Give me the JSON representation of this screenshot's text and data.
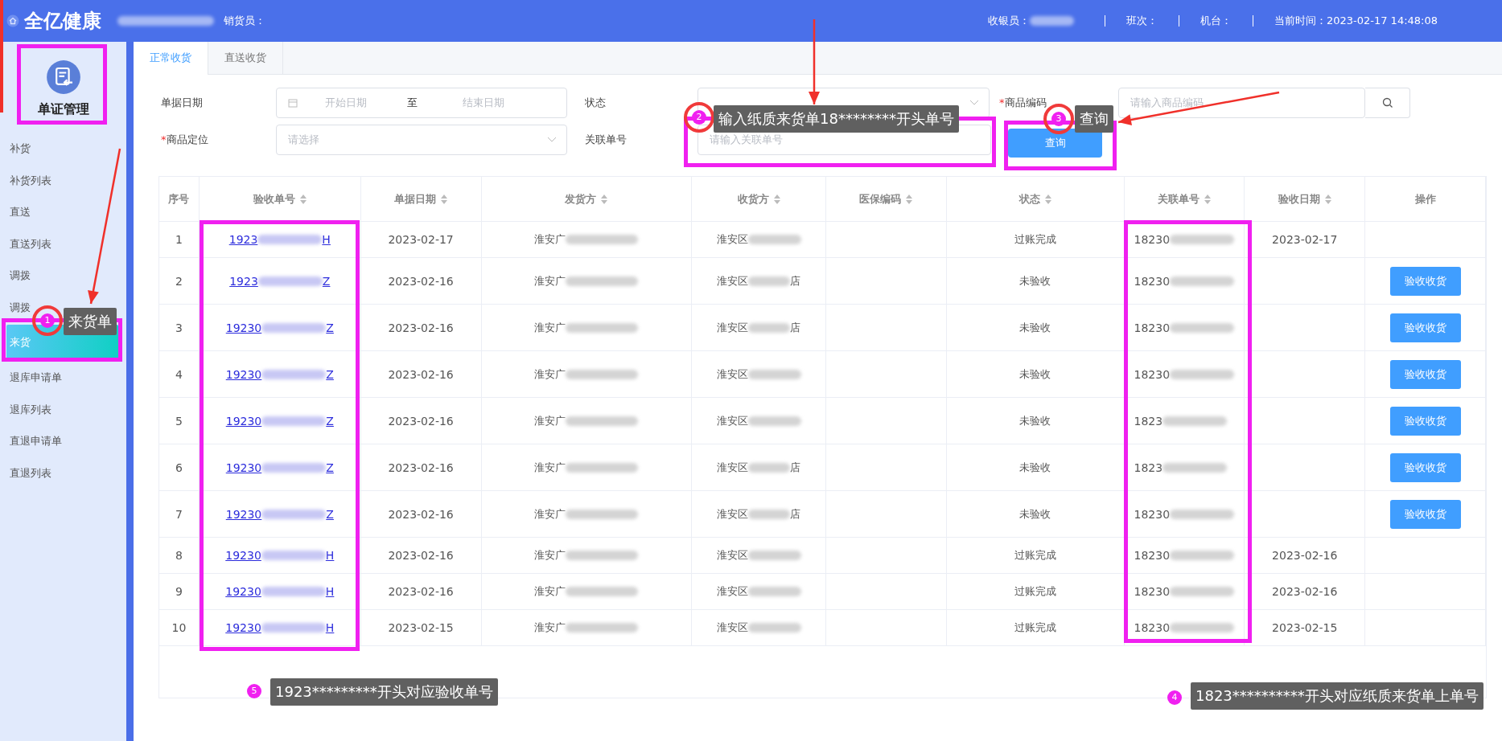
{
  "header": {
    "logo": "全亿健康",
    "seller_label": "销货员：",
    "cashier_label": "收银员：",
    "shift_label": "班次：",
    "terminal_label": "机台：",
    "time": "当前时间：2023-02-17 14:48:08"
  },
  "sidebar": {
    "title": "单证管理",
    "items": [
      {
        "label": "补货",
        "selected": false
      },
      {
        "label": "补货列表",
        "selected": false
      },
      {
        "label": "直送",
        "selected": false
      },
      {
        "label": "直送列表",
        "selected": false
      },
      {
        "label": "调拨",
        "selected": false
      },
      {
        "label": "调拨",
        "selected": false
      },
      {
        "label": "来货",
        "selected": true
      },
      {
        "label": "退库申请单",
        "selected": false
      },
      {
        "label": "退库列表",
        "selected": false
      },
      {
        "label": "直退申请单",
        "selected": false
      },
      {
        "label": "直退列表",
        "selected": false
      }
    ]
  },
  "tabs": [
    {
      "label": "正常收货",
      "selected": true
    },
    {
      "label": "直送收货",
      "selected": false
    }
  ],
  "filters": {
    "date_label": "单据日期",
    "date_start": "开始日期",
    "date_to": "至",
    "date_end": "结束日期",
    "status_label": "状态",
    "code_required_mark": "*",
    "code_label": "商品编码",
    "code_placeholder": "请输入商品编码",
    "location_required_mark": "*",
    "location_label": "商品定位",
    "location_placeholder": "请选择",
    "ref_label": "关联单号",
    "ref_placeholder": "请输入关联单号",
    "query_button": "查询"
  },
  "table": {
    "columns": [
      {
        "label": "序号",
        "sortable": false
      },
      {
        "label": "验收单号",
        "sortable": true
      },
      {
        "label": "单据日期",
        "sortable": true
      },
      {
        "label": "发货方",
        "sortable": true
      },
      {
        "label": "收货方",
        "sortable": true
      },
      {
        "label": "医保编码",
        "sortable": true
      },
      {
        "label": "状态",
        "sortable": true
      },
      {
        "label": "关联单号",
        "sortable": true
      },
      {
        "label": "验收日期",
        "sortable": true
      },
      {
        "label": "操作",
        "sortable": false
      }
    ],
    "rows": [
      {
        "seq": "1",
        "receipt_prefix": "1923",
        "receipt_suffix": "H",
        "date": "2023-02-17",
        "sender": "淮安广",
        "receiver": "淮安区",
        "receiver_suffix": "",
        "status": "过账完成",
        "ref": "18230",
        "check_date": "2023-02-17"
      },
      {
        "seq": "2",
        "receipt_prefix": "1923",
        "receipt_suffix": "Z",
        "date": "2023-02-16",
        "sender": "淮安广",
        "receiver": "淮安区",
        "receiver_suffix": "店",
        "status": "未验收",
        "ref": "18230",
        "action": "验收收货"
      },
      {
        "seq": "3",
        "receipt_prefix": "19230",
        "receipt_suffix": "Z",
        "date": "2023-02-16",
        "sender": "淮安广",
        "receiver": "淮安区",
        "receiver_suffix": "店",
        "status": "未验收",
        "ref": "18230",
        "action": "验收收货"
      },
      {
        "seq": "4",
        "receipt_prefix": "19230",
        "receipt_suffix": "Z",
        "date": "2023-02-16",
        "sender": "淮安广",
        "receiver": "淮安区",
        "receiver_suffix": "",
        "status": "未验收",
        "ref": "18230",
        "action": "验收收货"
      },
      {
        "seq": "5",
        "receipt_prefix": "19230",
        "receipt_suffix": "Z",
        "date": "2023-02-16",
        "sender": "淮安广",
        "receiver": "淮安区",
        "receiver_suffix": "",
        "status": "未验收",
        "ref": "1823",
        "action": "验收收货"
      },
      {
        "seq": "6",
        "receipt_prefix": "19230",
        "receipt_suffix": "Z",
        "date": "2023-02-16",
        "sender": "淮安广",
        "receiver": "淮安区",
        "receiver_suffix": "店",
        "status": "未验收",
        "ref": "1823",
        "action": "验收收货"
      },
      {
        "seq": "7",
        "receipt_prefix": "19230",
        "receipt_suffix": "Z",
        "date": "2023-02-16",
        "sender": "淮安广",
        "receiver": "淮安区",
        "receiver_suffix": "店",
        "status": "未验收",
        "ref": "18230",
        "action": "验收收货"
      },
      {
        "seq": "8",
        "receipt_prefix": "19230",
        "receipt_suffix": "H",
        "date": "2023-02-16",
        "sender": "淮安广",
        "receiver": "淮安区",
        "receiver_suffix": "",
        "status": "过账完成",
        "ref": "18230",
        "check_date": "2023-02-16"
      },
      {
        "seq": "9",
        "receipt_prefix": "19230",
        "receipt_suffix": "H",
        "date": "2023-02-16",
        "sender": "淮安广",
        "receiver": "淮安区",
        "receiver_suffix": "",
        "status": "过账完成",
        "ref": "18230",
        "check_date": "2023-02-16"
      },
      {
        "seq": "10",
        "receipt_prefix": "19230",
        "receipt_suffix": "H",
        "date": "2023-02-15",
        "sender": "淮安广",
        "receiver": "淮安区",
        "receiver_suffix": "",
        "status": "过账完成",
        "ref": "18230",
        "check_date": "2023-02-15"
      }
    ]
  },
  "annotations": [
    {
      "number": "1",
      "text": "来货单"
    },
    {
      "number": "2",
      "text": "输入纸质来货单18********开头单号"
    },
    {
      "number": "3",
      "text": "查询"
    },
    {
      "number": "5",
      "text": "1923*********开头对应验收单号"
    },
    {
      "number": "4",
      "text": "1823**********开头对应纸质来货单上单号"
    }
  ]
}
